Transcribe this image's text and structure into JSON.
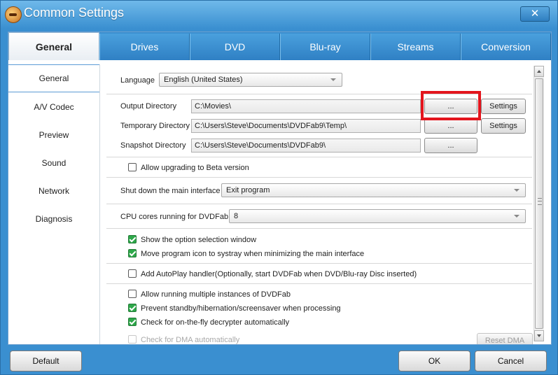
{
  "window": {
    "title": "Common Settings",
    "close_label": "✕"
  },
  "tabs": [
    {
      "label": "General"
    },
    {
      "label": "Drives"
    },
    {
      "label": "DVD"
    },
    {
      "label": "Blu-ray"
    },
    {
      "label": "Streams"
    },
    {
      "label": "Conversion"
    }
  ],
  "sidebar": {
    "items": [
      {
        "label": "General"
      },
      {
        "label": "A/V Codec"
      },
      {
        "label": "Preview"
      },
      {
        "label": "Sound"
      },
      {
        "label": "Network"
      },
      {
        "label": "Diagnosis"
      }
    ]
  },
  "general": {
    "language_label": "Language",
    "language_value": "English (United States)",
    "output_dir_label": "Output Directory",
    "output_dir_value": "C:\\Movies\\",
    "temp_dir_label": "Temporary Directory",
    "temp_dir_value": "C:\\Users\\Steve\\Documents\\DVDFab9\\Temp\\",
    "snapshot_dir_label": "Snapshot Directory",
    "snapshot_dir_value": "C:\\Users\\Steve\\Documents\\DVDFab9\\",
    "browse_label": "...",
    "settings_label": "Settings",
    "allow_beta_label": "Allow upgrading to Beta version",
    "shutdown_label": "Shut down the main interface",
    "shutdown_value": "Exit program",
    "cpu_label": "CPU cores running for DVDFab",
    "cpu_value": "8",
    "show_option_label": "Show the option selection window",
    "systray_label": "Move program icon to systray when minimizing the main interface",
    "autoplay_label": "Add AutoPlay handler(Optionally, start DVDFab when DVD/Blu-ray Disc inserted)",
    "multi_instance_label": "Allow running multiple instances of DVDFab",
    "standby_label": "Prevent standby/hibernation/screensaver when processing",
    "decrypter_label": "Check for on-the-fly decrypter automatically",
    "dma_label": "Check for DMA automatically",
    "reset_dma_label": "Reset DMA"
  },
  "checkbox_states": {
    "allow_beta": false,
    "show_option": true,
    "systray": true,
    "autoplay": false,
    "multi_instance": false,
    "standby": true,
    "decrypter": true,
    "dma": false
  },
  "footer": {
    "default_label": "Default",
    "ok_label": "OK",
    "cancel_label": "Cancel"
  },
  "colors": {
    "accent": "#3a8fd0",
    "highlight": "#e3151d",
    "check": "#2ea84a"
  }
}
